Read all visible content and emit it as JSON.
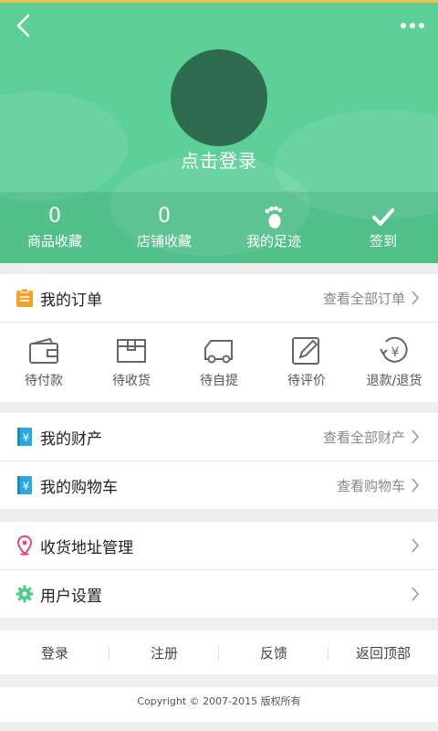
{
  "colors": {
    "accent": "#5dcf98",
    "avatar": "#2f6c4f",
    "order_icon": "#f0a42c",
    "finance_icon": "#2aa9e0",
    "location_icon": "#e8457a",
    "settings_icon": "#4dcc8c"
  },
  "header": {
    "login_text": "点击登录",
    "stats": [
      {
        "value": "0",
        "label": "商品收藏"
      },
      {
        "value": "0",
        "label": "店铺收藏"
      },
      {
        "icon": "footprint-icon",
        "label": "我的足迹"
      },
      {
        "icon": "checkmark-icon",
        "label": "签到"
      }
    ]
  },
  "orders": {
    "title": "我的订单",
    "view_all": "查看全部订单",
    "items": [
      {
        "icon": "wallet-icon",
        "label": "待付款"
      },
      {
        "icon": "box-icon",
        "label": "待收货"
      },
      {
        "icon": "truck-icon",
        "label": "待自提"
      },
      {
        "icon": "pen-icon",
        "label": "待评价"
      },
      {
        "icon": "refund-icon",
        "label": "退款/退货"
      }
    ]
  },
  "assets": {
    "title": "我的财产",
    "view_all": "查看全部财产"
  },
  "cart": {
    "title": "我的购物车",
    "view_all": "查看购物车"
  },
  "address": {
    "title": "收货地址管理"
  },
  "settings": {
    "title": "用户设置"
  },
  "footer": {
    "links": [
      "登录",
      "注册",
      "反馈",
      "返回顶部"
    ],
    "copyright": "Copyright © 2007-2015 版权所有"
  }
}
